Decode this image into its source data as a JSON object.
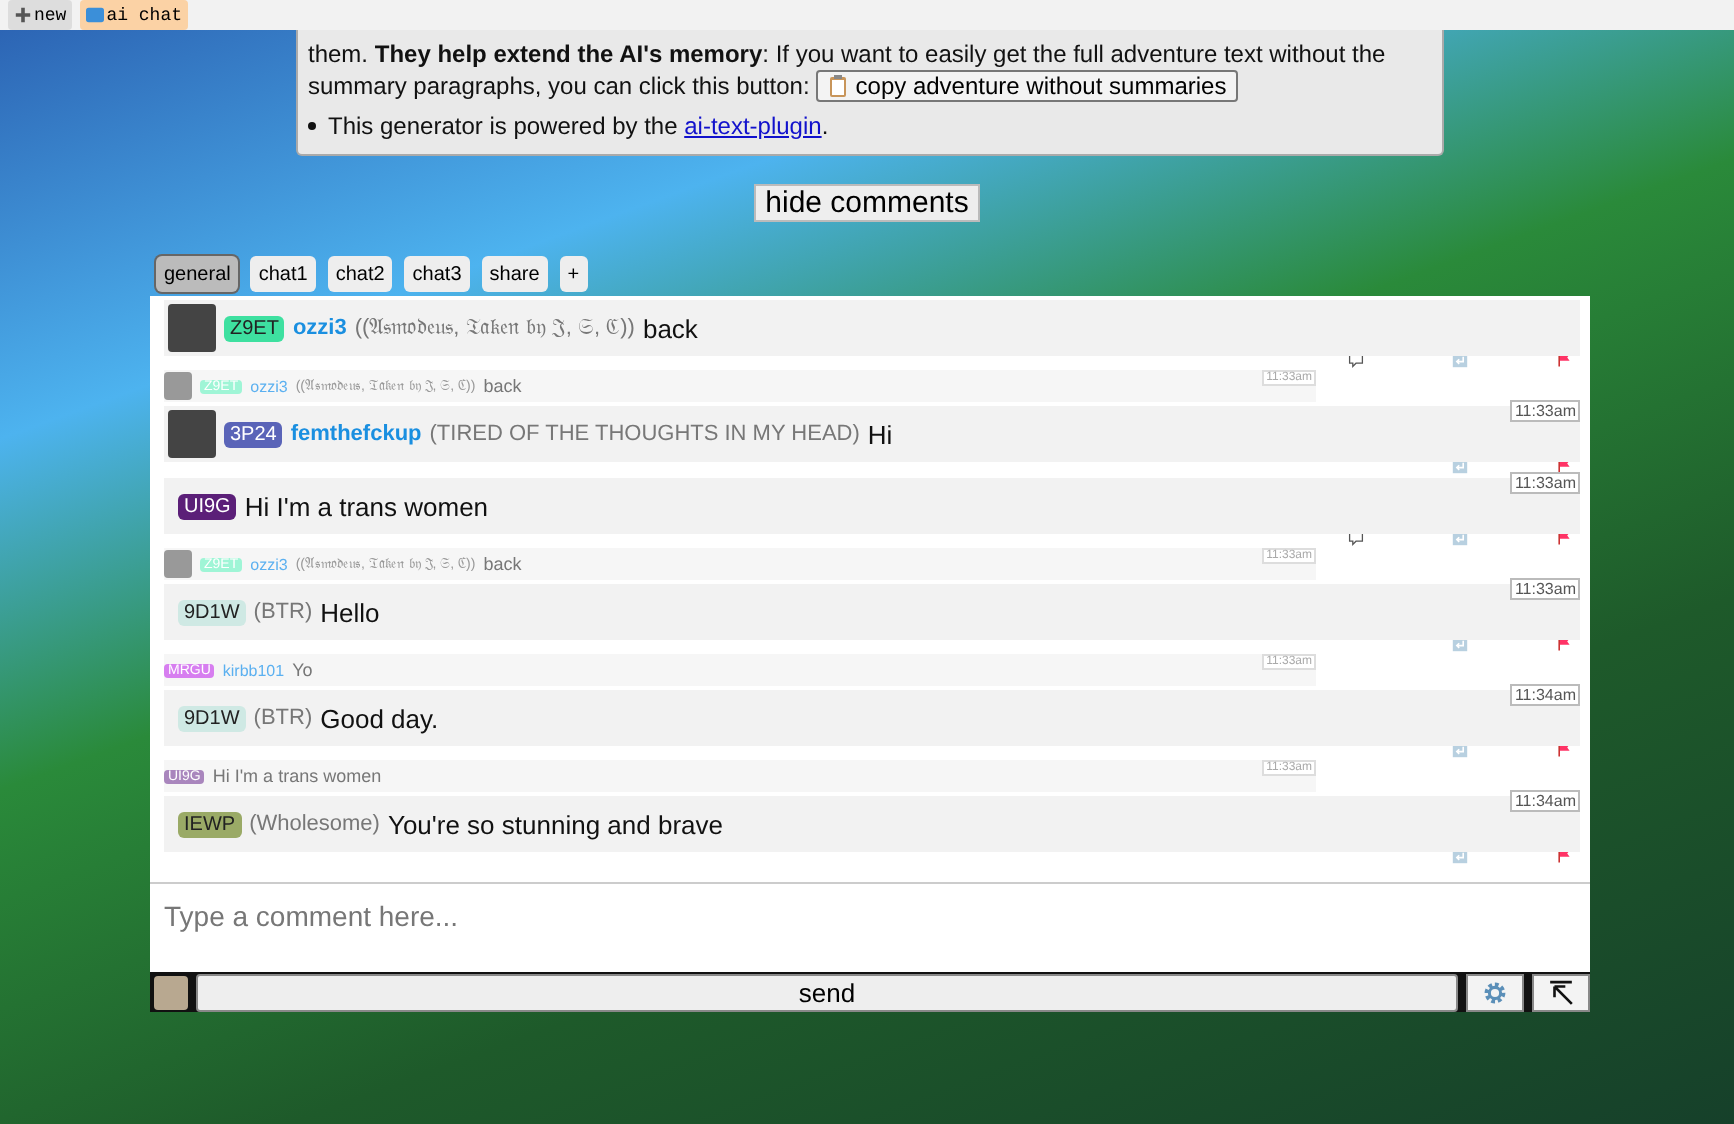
{
  "top_bar": {
    "buttons": [
      {
        "label": "new",
        "kind": "new"
      },
      {
        "label": "ai chat",
        "kind": "ai"
      }
    ]
  },
  "info_panel": {
    "lines": [
      {
        "texts": [
          "them. **They help extend the AI's memory**: If you want to easily get the full adventure text without the",
          "summary paragraphs, you can click this button:"
        ],
        "button": "copy adventure without summaries",
        "bullet": false
      },
      {
        "text": "This generator is powered by the ",
        "link": "ai-text-plugin",
        "after": ".",
        "bullet": true
      }
    ]
  },
  "hide_comments_button": "hide comments",
  "tabs": [
    {
      "label": "general",
      "selected": true
    },
    {
      "label": "chat1",
      "selected": false
    },
    {
      "label": "chat2",
      "selected": false
    },
    {
      "label": "chat3",
      "selected": false
    },
    {
      "label": "share",
      "selected": false
    },
    {
      "label": "+",
      "selected": false
    }
  ],
  "messages": [
    {
      "kind": "main",
      "avatar": true,
      "tag": "Z9ET",
      "color": "#3ee0a0",
      "user": "ozzi3",
      "title": "((𝔄𝔰𝔪𝔬𝔡𝔢𝔲𝔰, 𝔗𝔞𝔨𝔢𝔫 𝔟𝔶 𝔍, 𝔖, ℭ))",
      "text": "back",
      "comment_icon": true
    },
    {
      "kind": "compact",
      "avatar": true,
      "tag": "Z9ET",
      "color": "#9ff5d6",
      "user": "ozzi3",
      "title": "((𝔄𝔰𝔪𝔬𝔡𝔢𝔲𝔰, 𝔗𝔞𝔨𝔢𝔫 𝔟𝔶 𝔍, 𝔖, ℭ))",
      "text": "back",
      "time": "11:33am"
    },
    {
      "kind": "main",
      "avatar": true,
      "tag": "3P24",
      "color": "#5a64b8",
      "user": "femthefckup",
      "title": "(TIRED OF THE THOUGHTS IN MY HEAD)",
      "text": "Hi",
      "time": "11:33am",
      "comment_icon": false
    },
    {
      "kind": "main",
      "avatar": false,
      "tag": "UI9G",
      "color": "#5b1f78",
      "text": "Hi I'm a trans women",
      "time": "11:33am",
      "comment_icon": true
    },
    {
      "kind": "compact",
      "avatar": true,
      "tag": "Z9ET",
      "color": "#9ff5d6",
      "user": "ozzi3",
      "title": "((𝔄𝔰𝔪𝔬𝔡𝔢𝔲𝔰, 𝔗𝔞𝔨𝔢𝔫 𝔟𝔶 𝔍, 𝔖, ℭ))",
      "text": "back",
      "time": "11:33am"
    },
    {
      "kind": "main",
      "avatar": false,
      "tag": "9D1W",
      "color": "#cfe9e4",
      "title": "(BTR)",
      "text": "Hello",
      "time": "11:33am",
      "comment_icon": false
    },
    {
      "kind": "compact",
      "avatar": false,
      "tag": "MRGU",
      "color": "#d77ef0",
      "user": "kirbb101",
      "text": "Yo",
      "time": "11:33am"
    },
    {
      "kind": "main",
      "avatar": false,
      "tag": "9D1W",
      "color": "#cfe9e4",
      "title": "(BTR)",
      "text": "Good day.",
      "time": "11:34am",
      "comment_icon": false
    },
    {
      "kind": "compact",
      "avatar": false,
      "tag": "UI9G",
      "color": "#a986bd",
      "text": "Hi I'm a trans women",
      "time": "11:33am"
    },
    {
      "kind": "main",
      "avatar": false,
      "tag": "IEWP",
      "color": "#9aaa66",
      "title": "(Wholesome)",
      "text": "You're so stunning and brave",
      "time": "11:34am",
      "comment_icon": false
    }
  ],
  "composer": {
    "placeholder": "Type a comment here...",
    "send": "send"
  }
}
